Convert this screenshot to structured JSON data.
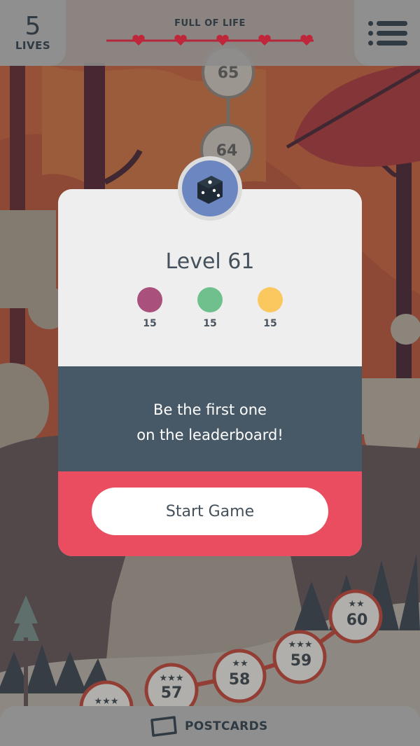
{
  "header": {
    "lives_count": "5",
    "lives_label": "LIVES",
    "life_status": "FULL OF LIFE",
    "hearts_filled": 5
  },
  "map": {
    "upper_levels": [
      "65",
      "64"
    ],
    "lower_levels": [
      "60",
      "59",
      "58",
      "57"
    ]
  },
  "card": {
    "title": "Level 61",
    "badge_icon": "dice-icon",
    "goals": [
      {
        "color": "#a9517c",
        "count": "15"
      },
      {
        "color": "#70c08e",
        "count": "15"
      },
      {
        "color": "#fbc85f",
        "count": "15"
      }
    ],
    "message_line1": "Be the first one",
    "message_line2": "on the leaderboard!",
    "start_button": "Start Game"
  },
  "footer": {
    "postcards_label": "POSTCARDS",
    "postcards_icon": "postcard-icon"
  },
  "colors": {
    "card_dark": "#475866",
    "card_red": "#ea4c60",
    "badge": "#6b86c0"
  }
}
